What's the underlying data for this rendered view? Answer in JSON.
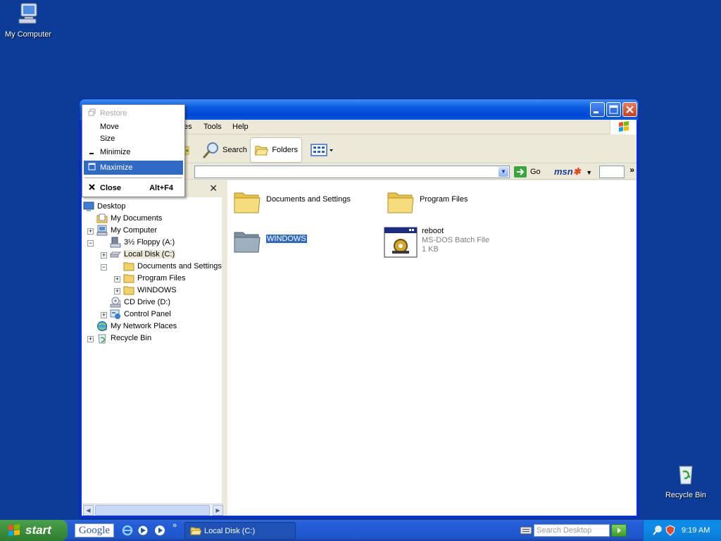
{
  "desktop": {
    "icons": [
      {
        "label": "My Computer",
        "icon": "my-computer-icon"
      },
      {
        "label": "Recycle Bin",
        "icon": "recycle-bin-icon"
      }
    ]
  },
  "window": {
    "menubar": {
      "partial_file_view_favorites": "es",
      "tools": "Tools",
      "help": "Help"
    },
    "toolbar": {
      "search": "Search",
      "folders": "Folders"
    },
    "addressbar": {
      "go": "Go",
      "msn": "msn"
    },
    "folders_pane": {
      "tree": [
        {
          "label": "Desktop",
          "icon": "desktop-icon"
        },
        {
          "label": "My Documents",
          "icon": "my-documents-icon"
        },
        {
          "label": "My Computer",
          "icon": "my-computer-icon"
        },
        {
          "label": "3½ Floppy (A:)",
          "icon": "floppy-icon"
        },
        {
          "label": "Local Disk (C:)",
          "icon": "hard-disk-icon"
        },
        {
          "label": "Documents and Settings",
          "icon": "folder-icon"
        },
        {
          "label": "Program Files",
          "icon": "folder-icon"
        },
        {
          "label": "WINDOWS",
          "icon": "folder-icon"
        },
        {
          "label": "CD Drive (D:)",
          "icon": "cd-drive-icon"
        },
        {
          "label": "Control Panel",
          "icon": "control-panel-icon"
        },
        {
          "label": "My Network Places",
          "icon": "network-places-icon"
        },
        {
          "label": "Recycle Bin",
          "icon": "recycle-bin-icon"
        }
      ]
    },
    "content": {
      "items": [
        {
          "name": "Documents and Settings",
          "icon": "folder-icon"
        },
        {
          "name": "Program Files",
          "icon": "folder-icon"
        },
        {
          "name": "WINDOWS",
          "icon": "folder-icon"
        },
        {
          "name": "reboot",
          "type": "MS-DOS Batch File",
          "size": "1 KB",
          "icon": "batch-file-icon"
        }
      ]
    }
  },
  "system_menu": {
    "restore": "Restore",
    "move": "Move",
    "size": "Size",
    "minimize": "Minimize",
    "maximize": "Maximize",
    "close": "Close",
    "close_accel": "Alt+F4"
  },
  "taskbar": {
    "start": "start",
    "google": "Google",
    "task_local_disk": "Local Disk (C:)",
    "search_placeholder": "Search Desktop",
    "clock": "9:19 AM",
    "chevron": "»"
  },
  "colors": {
    "desktop": "#0a3c98",
    "selection": "#316ac5",
    "face": "#ece9d8"
  }
}
